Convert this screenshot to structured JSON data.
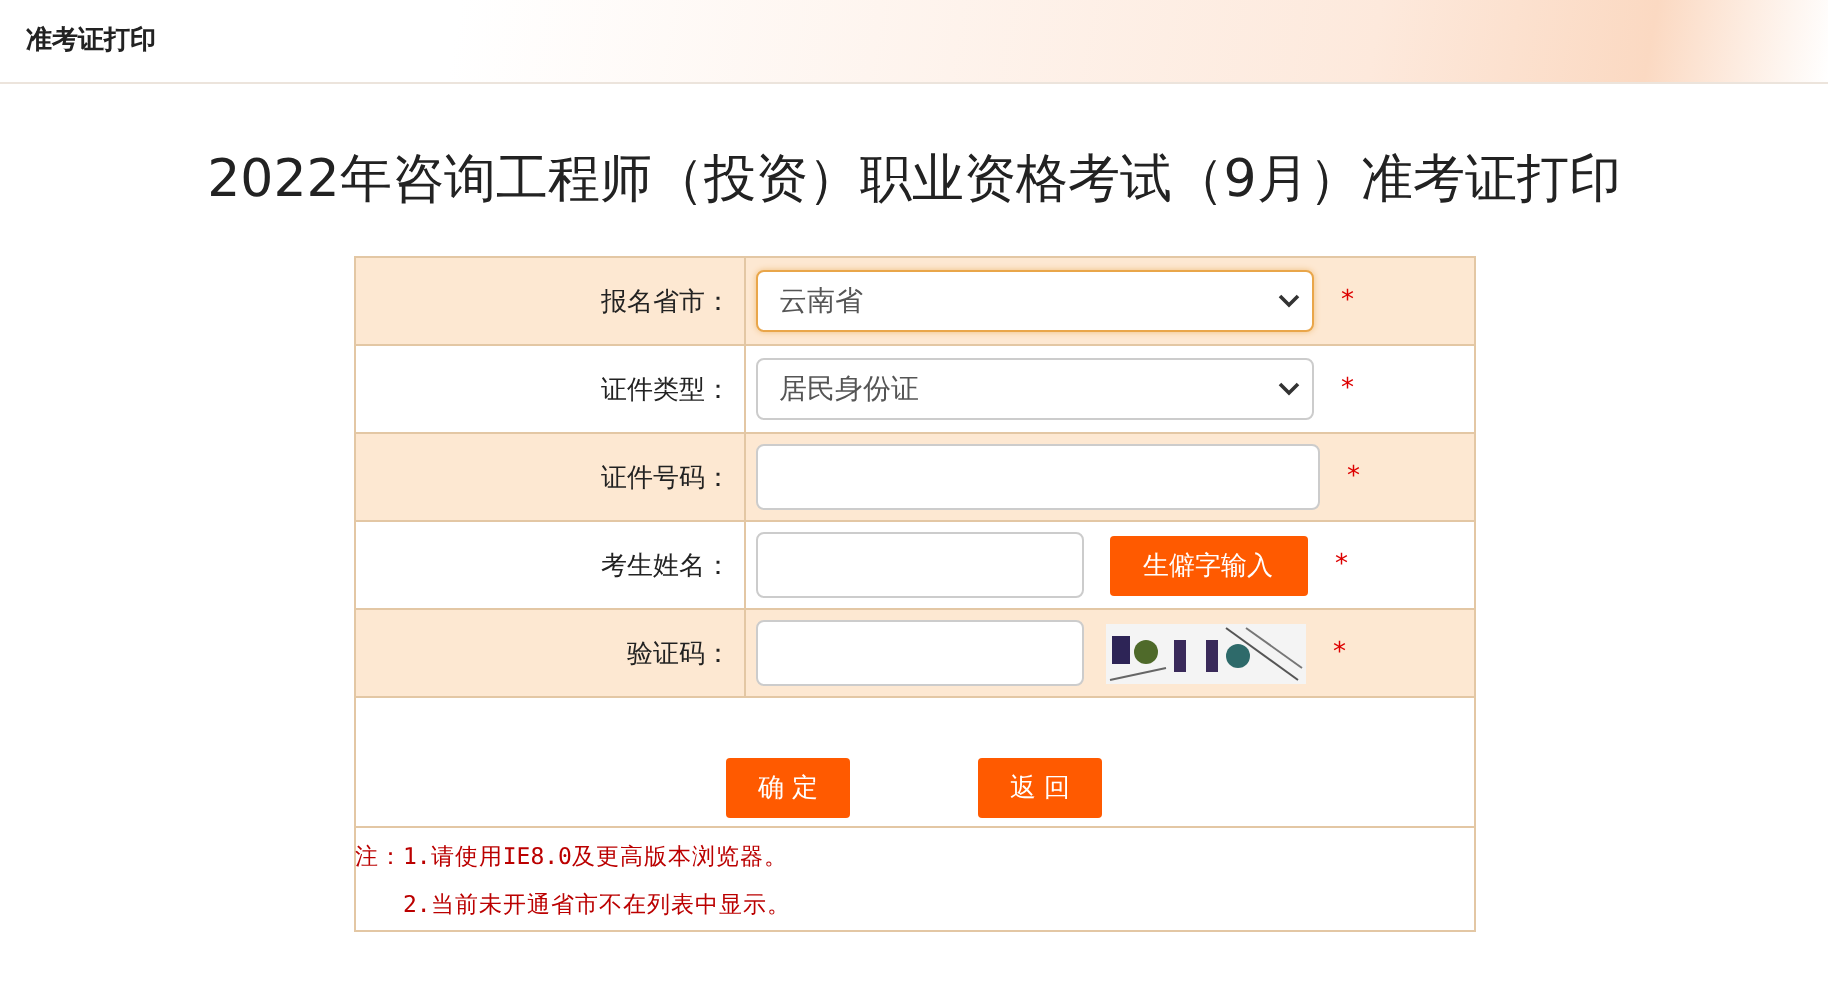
{
  "header": {
    "title": "准考证打印"
  },
  "page_title": "2022年咨询工程师（投资）职业资格考试（9月）准考证打印",
  "form": {
    "rows": [
      {
        "kind": "select",
        "label": "报名省市：",
        "value": "云南省",
        "focused": true,
        "required": "*"
      },
      {
        "kind": "select",
        "label": "证件类型：",
        "value": "居民身份证",
        "focused": false,
        "required": "*"
      },
      {
        "kind": "input",
        "label": "证件号码：",
        "focused": false,
        "required": "*"
      },
      {
        "kind": "input_button",
        "label": "考生姓名：",
        "focused": false,
        "button": "生僻字输入",
        "required": "*"
      },
      {
        "kind": "captcha",
        "label": "验证码：",
        "focused": false,
        "required": "*"
      }
    ],
    "buttons": [
      "确 定",
      "返 回"
    ],
    "notes": [
      "注：1.请使用IE8.0及更高版本浏览器。",
      "2.当前未开通省市不在列表中显示。"
    ]
  }
}
